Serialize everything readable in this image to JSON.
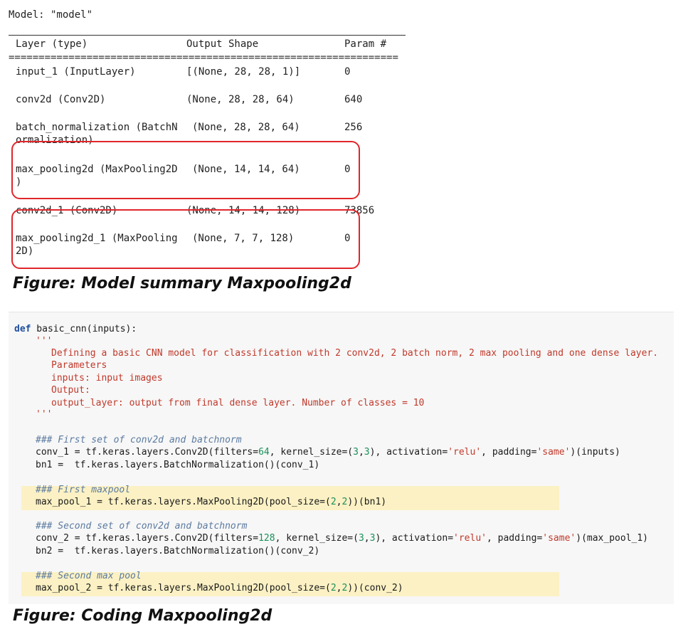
{
  "summary": {
    "model_line": "Model: \"model\"",
    "headers": {
      "layer": "Layer (type)",
      "shape": "Output Shape",
      "params": "Param #"
    },
    "equals": "=================================================================",
    "rows": [
      {
        "layer": "input_1 (InputLayer)",
        "layer2": "",
        "shape": "[(None, 28, 28, 1)]",
        "params": "0"
      },
      {
        "layer": "conv2d (Conv2D)",
        "layer2": "",
        "shape": "(None, 28, 28, 64)",
        "params": "640"
      },
      {
        "layer": "batch_normalization (BatchN",
        "layer2": "ormalization)",
        "shape": "(None, 28, 28, 64)",
        "params": "256"
      },
      {
        "layer": "max_pooling2d (MaxPooling2D",
        "layer2": ")",
        "shape": "(None, 14, 14, 64)",
        "params": "0"
      },
      {
        "layer": "conv2d_1 (Conv2D)",
        "layer2": "",
        "shape": "(None, 14, 14, 128)",
        "params": "73856"
      },
      {
        "layer": "max_pooling2d_1 (MaxPooling",
        "layer2": "2D)",
        "shape": "(None, 7, 7, 128)",
        "params": "0"
      }
    ],
    "highlight_color": "#e0262b"
  },
  "captions": {
    "summary": "Figure:  Model summary Maxpooling2d",
    "code": "Figure:  Coding Maxpooling2d"
  },
  "code": {
    "def_kw": "def",
    "def_rest": " basic_cnn(inputs):",
    "doc_open": "'''",
    "doc_lines": [
      "Defining a basic CNN model for classification with 2 conv2d, 2 batch norm, 2 max pooling and one dense layer.",
      "Parameters",
      "inputs: input images",
      "Output:",
      "output_layer: output from final dense layer. Number of classes = 10"
    ],
    "doc_close": "'''",
    "comment1": "### First set of conv2d and batchnorm",
    "conv1": {
      "a": "conv_1 = tf.keras.layers.Conv2D(filters=",
      "n1": "64",
      "b": ", kernel_size=(",
      "n2": "3",
      "c": ",",
      "n3": "3",
      "d": "), activation=",
      "s1": "'relu'",
      "e": ", padding=",
      "s2": "'same'",
      "f": ")(inputs)"
    },
    "bn1": "bn1 =  tf.keras.layers.BatchNormalization()(conv_1)",
    "comment2": "### First maxpool",
    "pool1": {
      "a": "max_pool_1 = tf.keras.layers.MaxPooling2D(pool_size=(",
      "n1": "2",
      "b": ",",
      "n2": "2",
      "c": "))(bn1)"
    },
    "comment3": "### Second set of conv2d and batchnorm",
    "conv2": {
      "a": "conv_2 = tf.keras.layers.Conv2D(filters=",
      "n1": "128",
      "b": ", kernel_size=(",
      "n2": "3",
      "c": ",",
      "n3": "3",
      "d": "), activation=",
      "s1": "'relu'",
      "e": ", padding=",
      "s2": "'same'",
      "f": ")(max_pool_1)"
    },
    "bn2": "bn2 =  tf.keras.layers.BatchNormalization()(conv_2)",
    "comment4": "### Second max pool",
    "pool2": {
      "a": "max_pool_2 = tf.keras.layers.MaxPooling2D(pool_size=(",
      "n1": "2",
      "b": ",",
      "n2": "2",
      "c": "))(conv_2)"
    },
    "highlight_color": "#fbf1c4"
  }
}
